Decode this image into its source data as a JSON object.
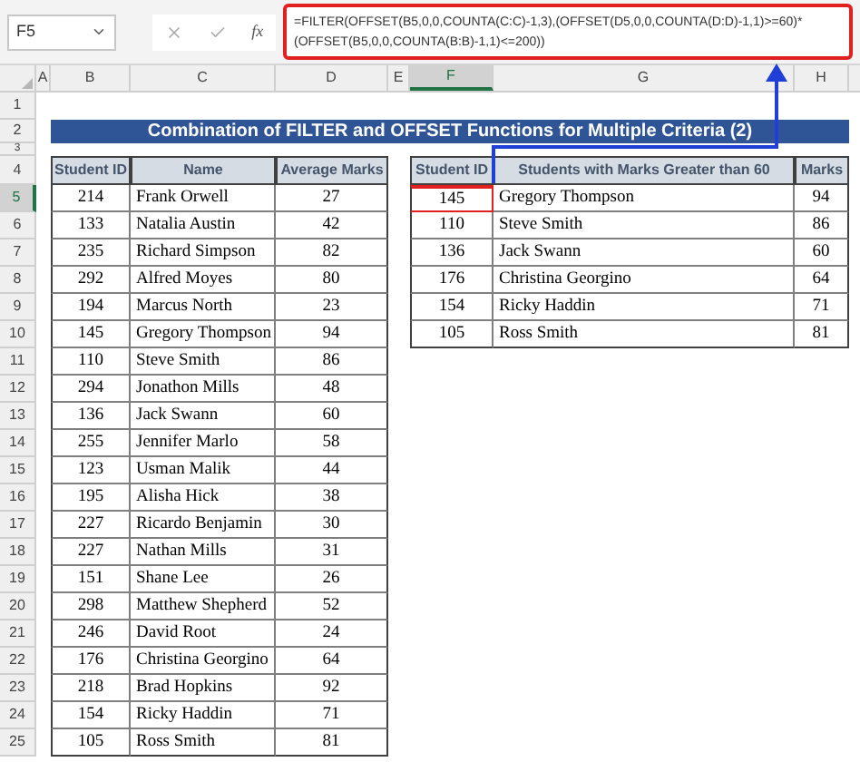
{
  "formula_bar": {
    "name_box": "F5",
    "fx": "fx",
    "formula_lines": [
      "=FILTER(OFFSET(B5,0,0,COUNTA(C:C)-1,3),(OFFSET(D5,0,0,COUNTA(D:D)-1,1)>=60)*",
      "(OFFSET(B5,0,0,COUNTA(B:B)-1,1)<=200))"
    ]
  },
  "columns": [
    {
      "label": "A",
      "selected": false
    },
    {
      "label": "B",
      "selected": false
    },
    {
      "label": "C",
      "selected": false
    },
    {
      "label": "D",
      "selected": false
    },
    {
      "label": "E",
      "selected": false
    },
    {
      "label": "F",
      "selected": true
    },
    {
      "label": "G",
      "selected": false
    },
    {
      "label": "H",
      "selected": false
    }
  ],
  "rows": [
    {
      "number": "1",
      "selected": false
    },
    {
      "number": "2",
      "selected": false
    },
    {
      "number": "3",
      "selected": false
    },
    {
      "number": "4",
      "selected": false
    },
    {
      "number": "5",
      "selected": true
    },
    {
      "number": "6",
      "selected": false
    },
    {
      "number": "7",
      "selected": false
    },
    {
      "number": "8",
      "selected": false
    },
    {
      "number": "9",
      "selected": false
    },
    {
      "number": "10",
      "selected": false
    },
    {
      "number": "11",
      "selected": false
    },
    {
      "number": "12",
      "selected": false
    },
    {
      "number": "13",
      "selected": false
    },
    {
      "number": "14",
      "selected": false
    },
    {
      "number": "15",
      "selected": false
    },
    {
      "number": "16",
      "selected": false
    },
    {
      "number": "17",
      "selected": false
    },
    {
      "number": "18",
      "selected": false
    },
    {
      "number": "19",
      "selected": false
    },
    {
      "number": "20",
      "selected": false
    },
    {
      "number": "21",
      "selected": false
    },
    {
      "number": "22",
      "selected": false
    },
    {
      "number": "23",
      "selected": false
    },
    {
      "number": "24",
      "selected": false
    },
    {
      "number": "25",
      "selected": false
    }
  ],
  "title": "Combination of FILTER and OFFSET Functions for Multiple Criteria (2)",
  "left_table": {
    "columns": [
      "Student ID",
      "Name",
      "Average Marks"
    ],
    "rows": [
      [
        "214",
        "Frank Orwell",
        "27"
      ],
      [
        "133",
        "Natalia Austin",
        "42"
      ],
      [
        "235",
        "Richard Simpson",
        "82"
      ],
      [
        "292",
        "Alfred Moyes",
        "80"
      ],
      [
        "194",
        "Marcus North",
        "23"
      ],
      [
        "145",
        "Gregory Thompson",
        "94"
      ],
      [
        "110",
        "Steve Smith",
        "86"
      ],
      [
        "294",
        "Jonathon Mills",
        "48"
      ],
      [
        "136",
        "Jack Swann",
        "60"
      ],
      [
        "255",
        "Jennifer Marlo",
        "58"
      ],
      [
        "123",
        "Usman Malik",
        "44"
      ],
      [
        "195",
        "Alisha Hick",
        "38"
      ],
      [
        "227",
        "Ricardo Benjamin",
        "30"
      ],
      [
        "227",
        "Nathan Mills",
        "31"
      ],
      [
        "151",
        "Shane Lee",
        "26"
      ],
      [
        "298",
        "Matthew Shepherd",
        "52"
      ],
      [
        "246",
        "David Root",
        "24"
      ],
      [
        "176",
        "Christina Georgino",
        "64"
      ],
      [
        "218",
        "Brad Hopkins",
        "92"
      ],
      [
        "154",
        "Ricky Haddin",
        "71"
      ],
      [
        "105",
        "Ross Smith",
        "81"
      ]
    ]
  },
  "right_table": {
    "columns": [
      "Student ID",
      "Students with Marks Greater than 60",
      "Marks"
    ],
    "rows": [
      {
        "cells": [
          "145",
          "Gregory Thompson",
          "94"
        ],
        "highlighted": true
      },
      {
        "cells": [
          "110",
          "Steve Smith",
          "86"
        ],
        "highlighted": false
      },
      {
        "cells": [
          "136",
          "Jack Swann",
          "60"
        ],
        "highlighted": false
      },
      {
        "cells": [
          "176",
          "Christina Georgino",
          "64"
        ],
        "highlighted": false
      },
      {
        "cells": [
          "154",
          "Ricky Haddin",
          "71"
        ],
        "highlighted": false
      },
      {
        "cells": [
          "105",
          "Ross Smith",
          "81"
        ],
        "highlighted": false
      }
    ]
  }
}
